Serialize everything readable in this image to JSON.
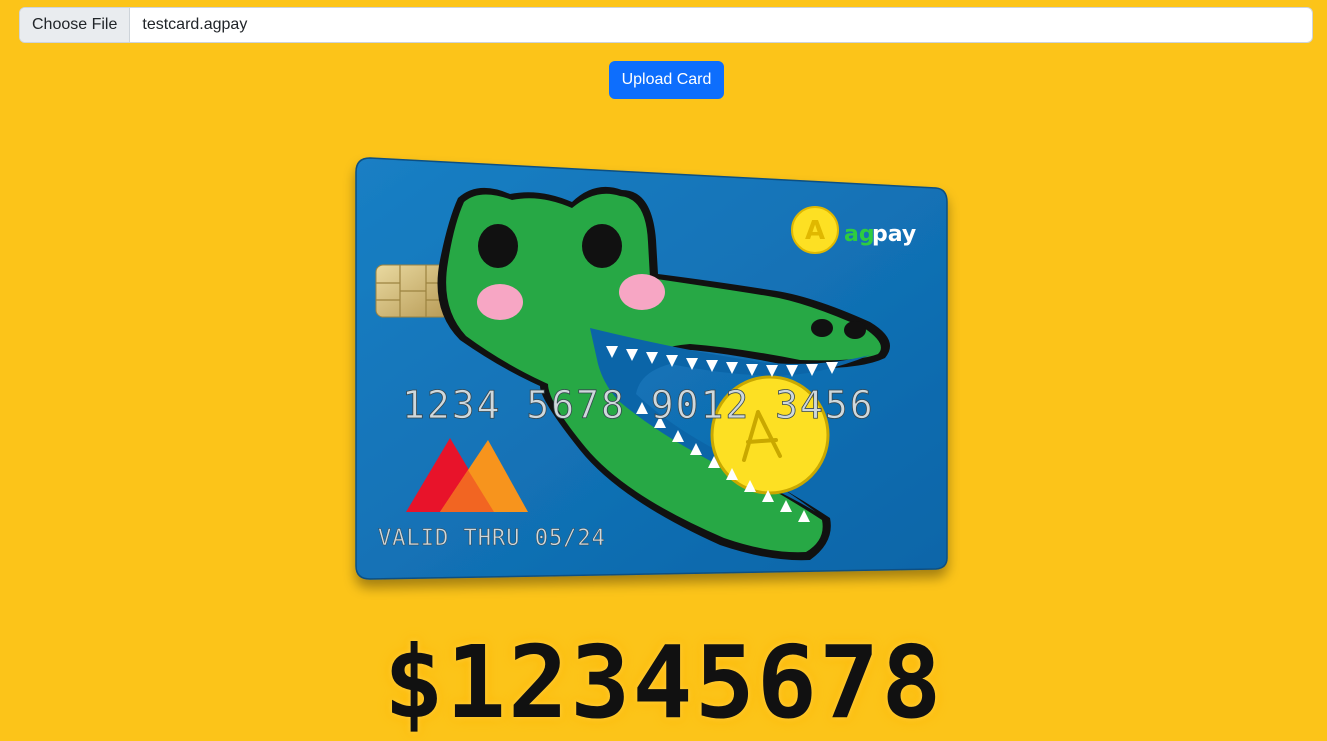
{
  "file_input": {
    "button_label": "Choose File",
    "file_name": "testcard.agpay"
  },
  "upload_button": {
    "label": "Upload Card"
  },
  "card": {
    "number": "1234 5678 9012 3456",
    "valid_thru": "VALID THRU 05/24",
    "brand_prefix": "ag",
    "brand_suffix": "pay",
    "logo_letter": "A",
    "colors": {
      "card_blue": "#0e6fb5",
      "crocodile_green": "#27a845",
      "coin_yellow": "#fde023",
      "accent_red": "#e8132a",
      "accent_orange": "#f7941d"
    }
  },
  "balance": {
    "amount": "$12345678"
  },
  "colors": {
    "background": "#fcc419",
    "button_primary": "#0d6efd"
  }
}
